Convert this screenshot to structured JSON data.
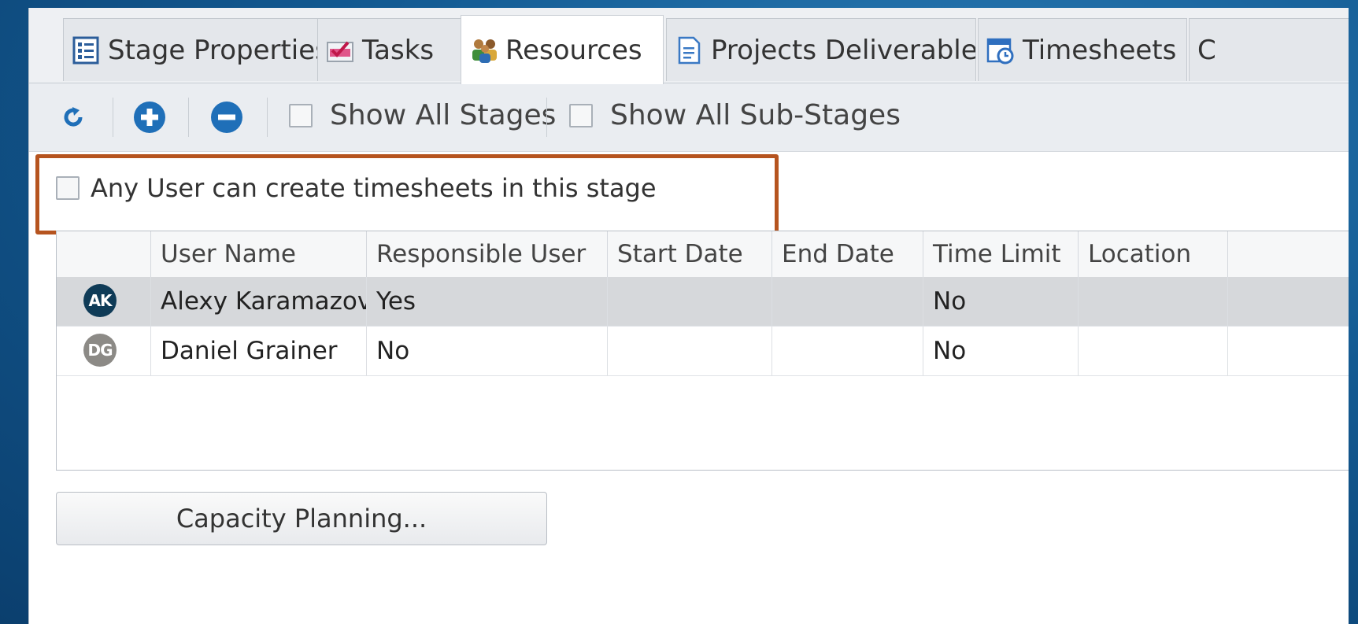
{
  "tabs": [
    {
      "label": "Stage Properties",
      "icon": "stage-properties-icon"
    },
    {
      "label": "Tasks",
      "icon": "tasks-icon"
    },
    {
      "label": "Resources",
      "icon": "resources-icon",
      "active": true
    },
    {
      "label": "Projects Deliverables",
      "icon": "deliverables-icon"
    },
    {
      "label": "Timesheets",
      "icon": "timesheets-icon"
    },
    {
      "label": "C",
      "icon": ""
    }
  ],
  "toolbar": {
    "refresh_icon": "refresh-icon",
    "add_icon": "add-icon",
    "remove_icon": "remove-icon",
    "show_all_stages": {
      "label": "Show All Stages",
      "checked": false
    },
    "show_all_substages": {
      "label": "Show All Sub-Stages",
      "checked": false
    }
  },
  "any_user": {
    "label": "Any User can create timesheets in this stage",
    "checked": false
  },
  "grid": {
    "columns": [
      "User Name",
      "Responsible User",
      "Start Date",
      "End Date",
      "Time Limit",
      "Location"
    ],
    "rows": [
      {
        "initials": "AK",
        "avatar_color": "#0f3b57",
        "user_name": "Alexy Karamazov",
        "responsible": "Yes",
        "start": "",
        "end": "",
        "time_limit": "No",
        "location": "",
        "selected": true
      },
      {
        "initials": "DG",
        "avatar_color": "#8c8a86",
        "user_name": "Daniel Grainer",
        "responsible": "No",
        "start": "",
        "end": "",
        "time_limit": "No",
        "location": "",
        "selected": false
      }
    ]
  },
  "capacity_button": "Capacity Planning...",
  "colors": {
    "highlight": "#b6541f",
    "add_remove": "#1f6fb8"
  }
}
